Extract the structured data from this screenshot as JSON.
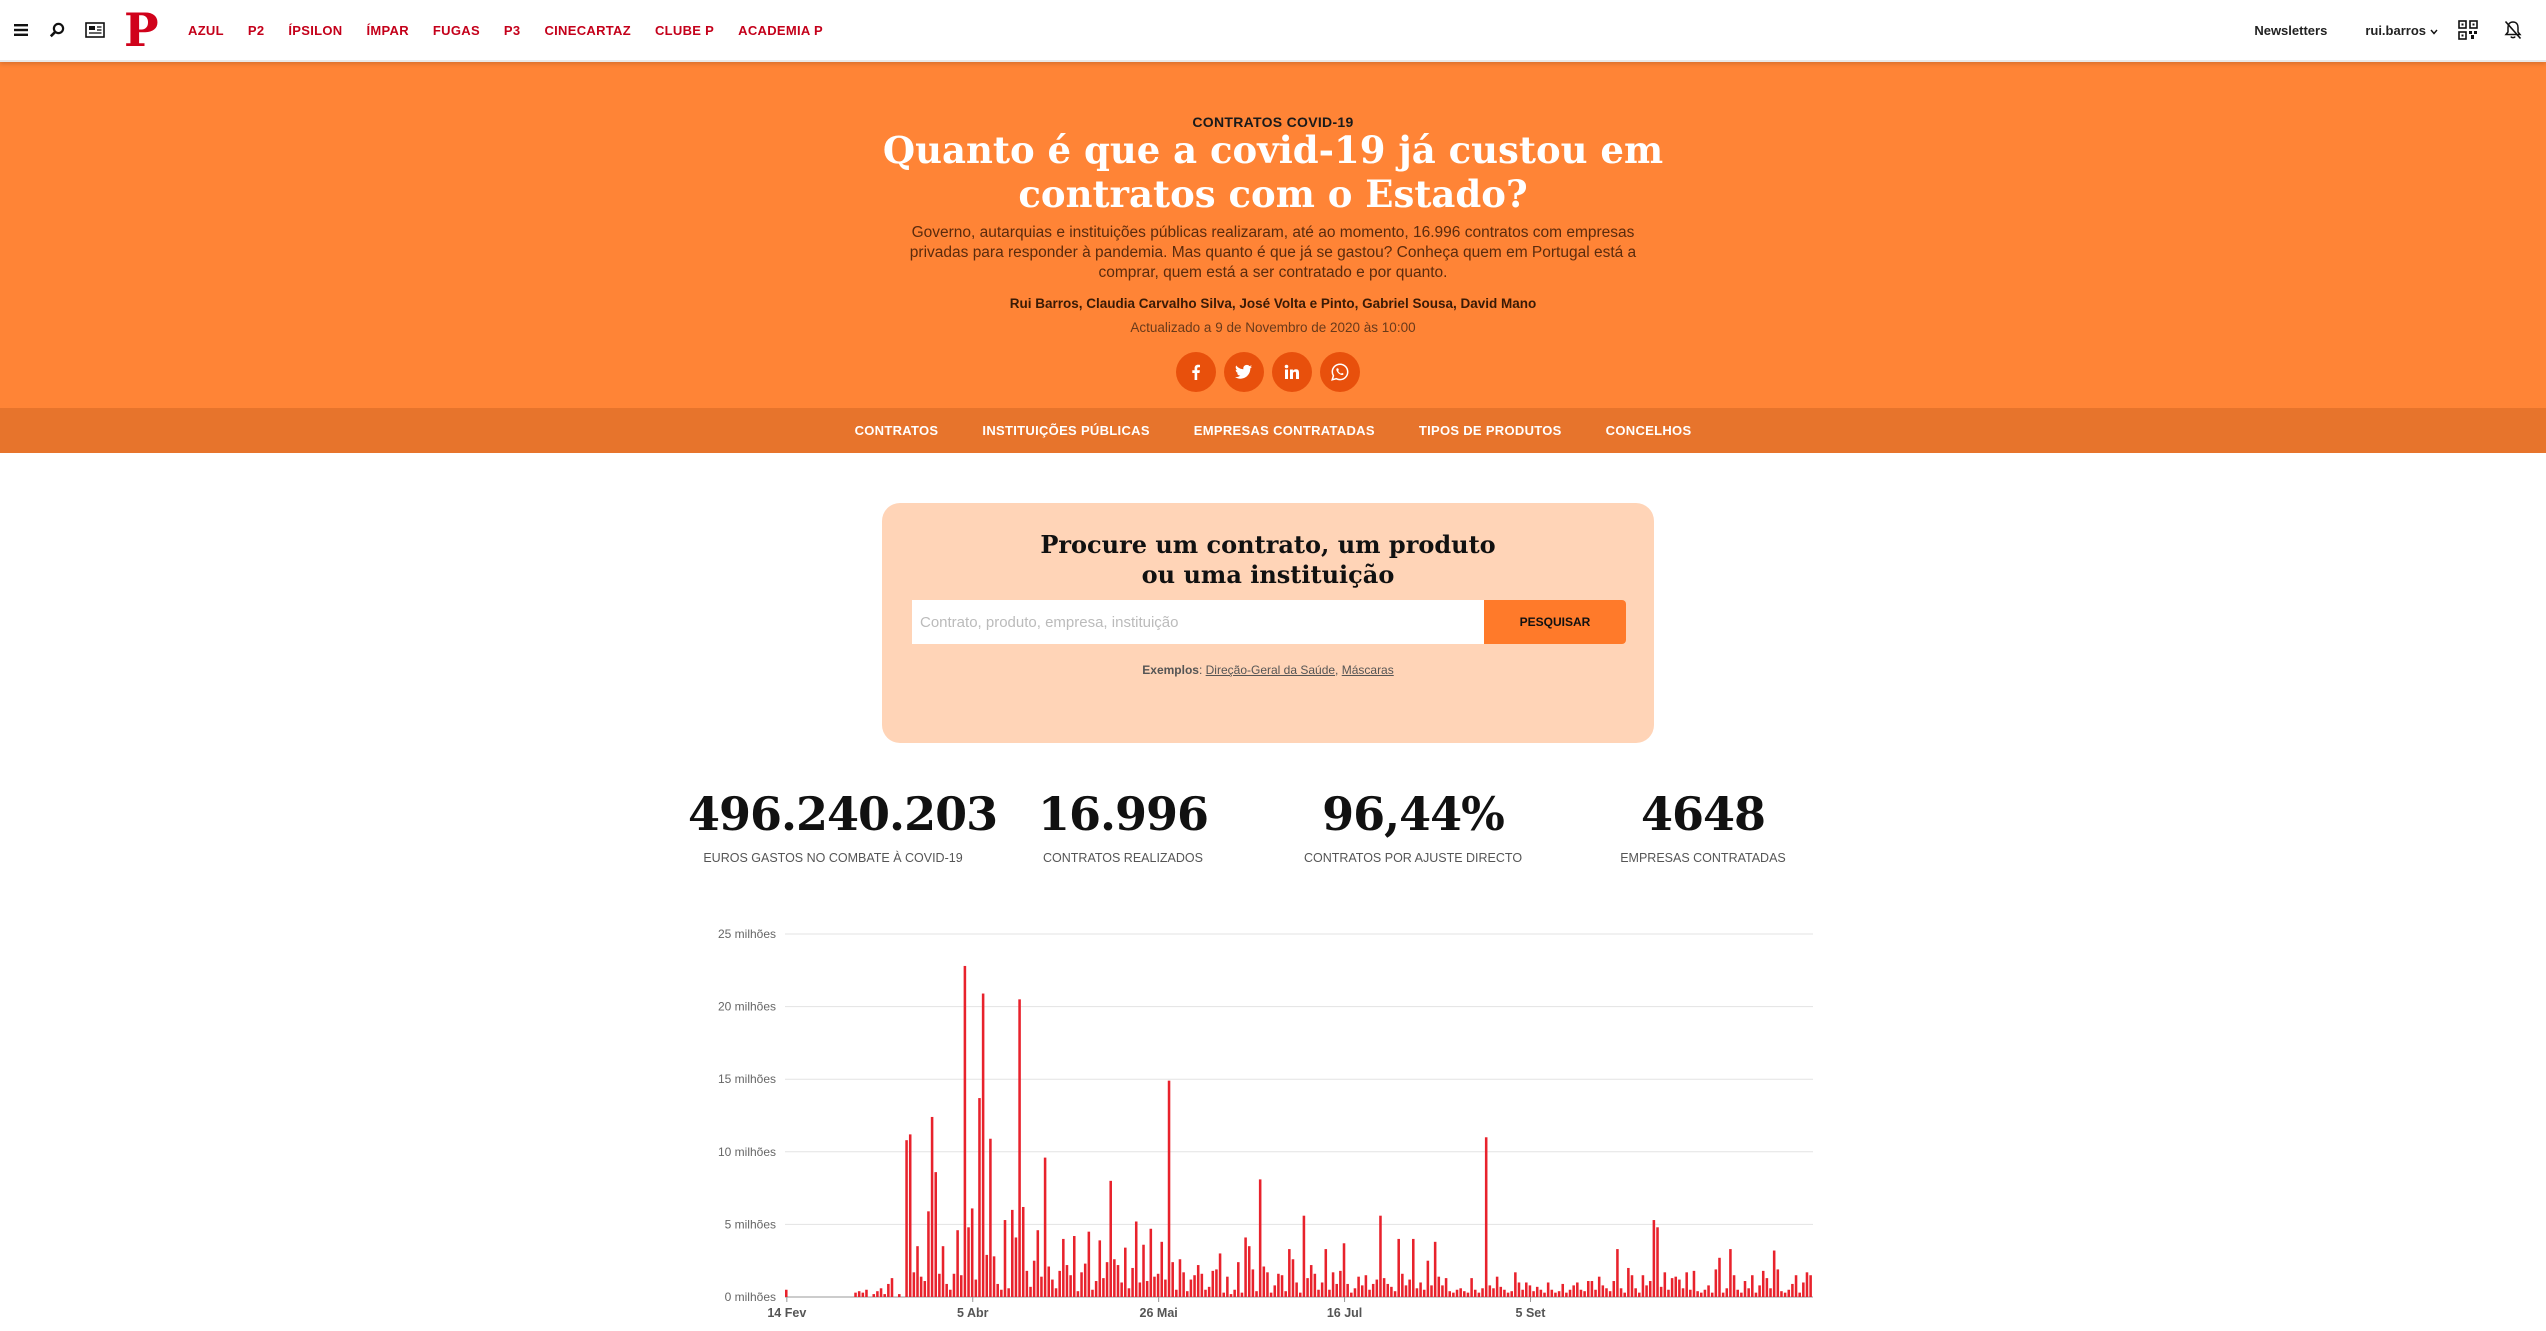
{
  "topbar": {
    "nav": [
      "AZUL",
      "P2",
      "ÍPSILON",
      "ÍMPAR",
      "FUGAS",
      "P3",
      "CINECARTAZ",
      "CLUBE P",
      "ACADEMIA P"
    ],
    "logo": "P",
    "newsletters": "Newsletters",
    "user": "rui.barros",
    "icons": [
      "menu-icon",
      "search-icon",
      "newspaper-icon",
      "qr-code-icon",
      "notifications-off-icon"
    ]
  },
  "hero": {
    "kicker": "CONTRATOS COVID-19",
    "title": "Quanto é que a covid-19 já custou em contratos com o Estado?",
    "standfirst": "Governo, autarquias e instituições públicas realizaram, até ao momento, 16.996 contratos com empresas privadas para responder à pandemia. Mas quanto é que já se gastou? Conheça quem em Portugal está a comprar, quem está a ser contratado e por quanto.",
    "authors": [
      "Rui Barros",
      "Claudia Carvalho Silva",
      "José Volta e Pinto",
      "Gabriel Sousa",
      "David Mano"
    ],
    "updated": "Actualizado a 9 de Novembro de 2020 às 10:00",
    "share": [
      "facebook-icon",
      "twitter-icon",
      "linkedin-icon",
      "whatsapp-icon"
    ]
  },
  "subnav": [
    "CONTRATOS",
    "INSTITUIÇÕES PÚBLICAS",
    "EMPRESAS CONTRATADAS",
    "TIPOS DE PRODUTOS",
    "CONCELHOS"
  ],
  "search": {
    "title_line1": "Procure um contrato, um produto",
    "title_line2": "ou uma instituição",
    "placeholder": "Contrato, produto, empresa, instituição",
    "button": "PESQUISAR",
    "examples_label": "Exemplos",
    "examples": [
      "Direção-Geral da Saúde",
      "Máscaras"
    ]
  },
  "stats": [
    {
      "value": "496.240.203",
      "label": "EUROS GASTOS NO COMBATE À COVID-19"
    },
    {
      "value": "16.996",
      "label": "CONTRATOS REALIZADOS"
    },
    {
      "value": "96,44%",
      "label": "CONTRATOS POR AJUSTE DIRECTO"
    },
    {
      "value": "4648",
      "label": "EMPRESAS CONTRATADAS"
    }
  ],
  "colors": {
    "accent": "#ff8436",
    "subnav": "#e7742c",
    "brand_red": "#d0021b",
    "bar": "#e8222c"
  },
  "chart_data": {
    "type": "bar",
    "ylabel": "",
    "xlabel": "",
    "ylim": [
      0,
      25
    ],
    "y_ticks": [
      0,
      5,
      10,
      15,
      20,
      25
    ],
    "y_tick_labels": [
      "0 milhões",
      "5 milhões",
      "10 milhões",
      "15 milhões",
      "20 milhões",
      "25 milhões"
    ],
    "x_tick_labels": [
      "14 Fev",
      "5 Abr",
      "26 Mai",
      "16 Jul",
      "5 Set"
    ],
    "x_tick_days": [
      0,
      51,
      102,
      153,
      204
    ],
    "grid": true,
    "series": [
      {
        "values": [
          0.5,
          0,
          0,
          0,
          0,
          0,
          0,
          0,
          0,
          0,
          0,
          0,
          0,
          0,
          0,
          0,
          0,
          0,
          0,
          0.3,
          0.4,
          0.3,
          0.5,
          0,
          0.2,
          0.4,
          0.6,
          0.2,
          0.9,
          1.3,
          0,
          0.2,
          0,
          10.8,
          11.2,
          1.7,
          3.5,
          1.4,
          1.1,
          5.9,
          12.4,
          8.6,
          1.6,
          3.5,
          0.9,
          0.5,
          1.6,
          4.6,
          1.5,
          22.8,
          4.8,
          6.1,
          1.2,
          13.7,
          20.9,
          2.9,
          10.9,
          2.8,
          0.9,
          0.5,
          5.3,
          0.6,
          6.0,
          4.1,
          20.5,
          6.2,
          1.8,
          0.7,
          2.5,
          4.6,
          1.4,
          9.6,
          2.1,
          1.2,
          0.6,
          1.8,
          4.0,
          2.2,
          1.5,
          4.2,
          0.4,
          1.7,
          2.3,
          4.5,
          0.5,
          1.1,
          3.9,
          1.3,
          2.4,
          8.0,
          2.6,
          2.2,
          1.0,
          3.4,
          0.6,
          2.0,
          5.2,
          1.0,
          3.6,
          1.1,
          4.7,
          1.4,
          1.6,
          3.8,
          1.2,
          14.9,
          2.4,
          0.5,
          2.6,
          1.7,
          0.4,
          1.2,
          1.5,
          2.2,
          1.6,
          0.5,
          0.7,
          1.8,
          1.9,
          3.0,
          0.3,
          1.4,
          0.2,
          0.5,
          2.4,
          0.3,
          4.1,
          3.5,
          1.9,
          0.4,
          8.1,
          2.1,
          1.7,
          0.3,
          0.8,
          1.6,
          1.5,
          0.4,
          3.3,
          2.6,
          1.0,
          0.3,
          5.6,
          1.3,
          2.2,
          1.6,
          0.5,
          1.0,
          3.3,
          0.5,
          1.7,
          0.9,
          1.8,
          3.7,
          0.9,
          0.3,
          0.6,
          1.4,
          0.8,
          1.5,
          0.5,
          0.9,
          1.2,
          5.6,
          1.3,
          0.9,
          0.7,
          0.4,
          4.0,
          1.6,
          0.8,
          1.2,
          4.0,
          0.6,
          1.0,
          0.5,
          2.5,
          0.8,
          3.8,
          1.4,
          0.8,
          1.3,
          0.4,
          0.3,
          0.5,
          0.6,
          0.4,
          0.3,
          1.3,
          0.5,
          0.3,
          0.6,
          11.0,
          0.8,
          0.6,
          1.4,
          0.7,
          0.5,
          0.3,
          0.4,
          1.7,
          1.0,
          0.5,
          1.0,
          0.8,
          0.4,
          0.7,
          0.5,
          0.3,
          1.0,
          0.5,
          0.3,
          0.4,
          0.9,
          0.3,
          0.5,
          0.8,
          1.0,
          0.5,
          0.4,
          1.1,
          1.1,
          0.5,
          1.4,
          0.8,
          0.6,
          0.4,
          1.1,
          3.3,
          0.6,
          0.3,
          2.0,
          1.5,
          0.6,
          0.3,
          1.5,
          0.8,
          1.1,
          5.3,
          4.8,
          0.7,
          1.7,
          0.5,
          1.3,
          1.4,
          1.2,
          0.6,
          1.7,
          0.5,
          1.8,
          0.4,
          0.3,
          0.5,
          0.8,
          0.3,
          1.9,
          2.7,
          0.3,
          0.6,
          3.3,
          1.5,
          0.5,
          0.3,
          1.1,
          0.6,
          1.5,
          0.3,
          0.8,
          1.8,
          1.3,
          0.6,
          3.2,
          1.9,
          0.4,
          0.3,
          0.5,
          0.9,
          1.5,
          0.3,
          1.0,
          1.7,
          1.5
        ]
      }
    ]
  }
}
